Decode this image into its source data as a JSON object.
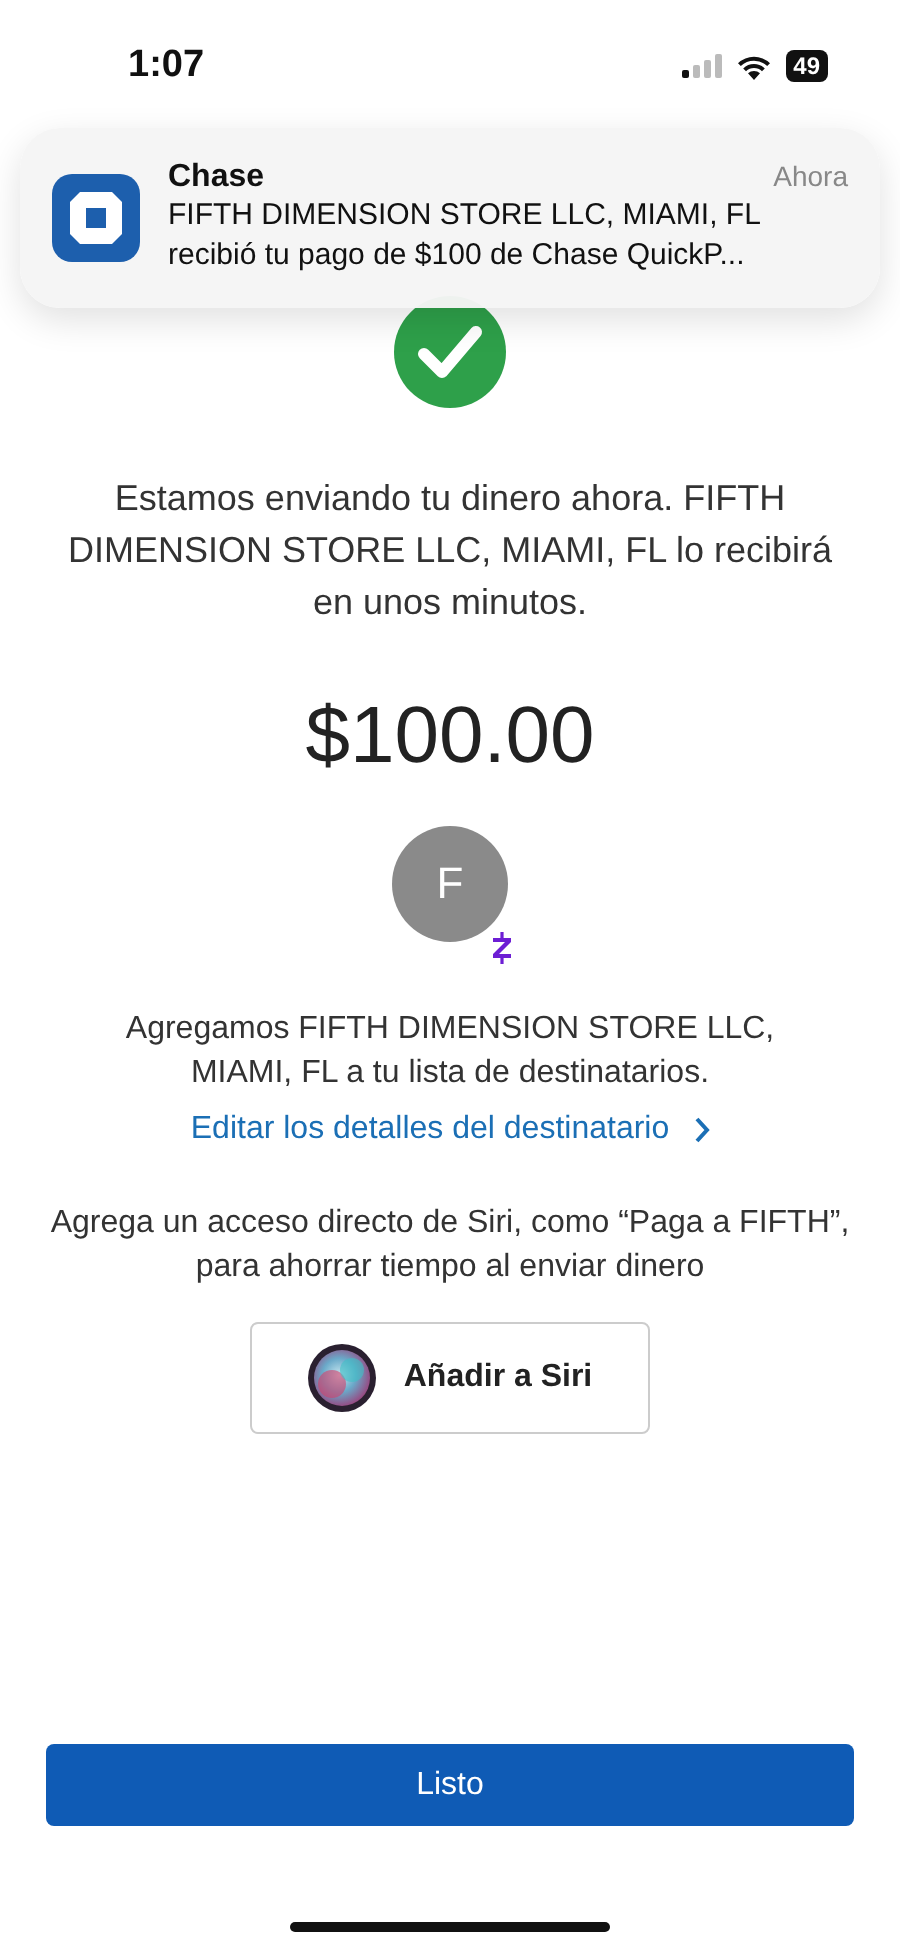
{
  "status_bar": {
    "time": "1:07",
    "battery": "49"
  },
  "notification": {
    "app": "Chase",
    "time": "Ahora",
    "line_1": "FIFTH DIMENSION STORE LLC, MIAMI, FL",
    "line_2": "recibió tu pago de $100 de Chase QuickP..."
  },
  "message": "Estamos enviando tu dinero ahora. FIFTH DIMENSION STORE LLC, MIAMI, FL lo recibirá en unos minutos.",
  "amount": "$100.00",
  "recipient": {
    "initial": "F"
  },
  "added_text": "Agregamos FIFTH DIMENSION STORE LLC, MIAMI, FL a tu lista de destinatarios.",
  "edit_link": "Editar los detalles del destinatario",
  "siri_text": "Agrega un acceso directo de Siri, como “Paga a FIFTH”, para ahorrar tiempo al enviar dinero",
  "siri_button": "Añadir a Siri",
  "done_button": "Listo"
}
